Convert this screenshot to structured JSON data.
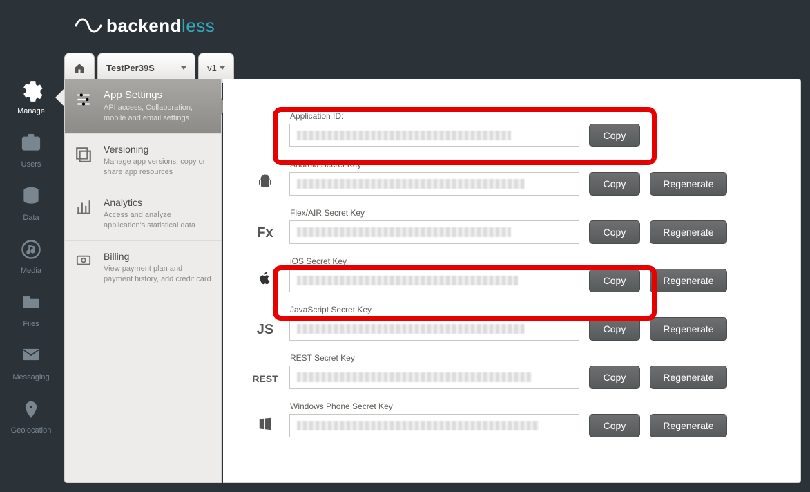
{
  "brand": {
    "name_a": "backend",
    "name_b": "less"
  },
  "app_selector": {
    "project": "TestPer39S",
    "version": "v1"
  },
  "left_rail": [
    {
      "id": "manage",
      "label": "Manage",
      "glyph": "gear",
      "active": true
    },
    {
      "id": "users",
      "label": "Users",
      "glyph": "idcard",
      "active": false
    },
    {
      "id": "data",
      "label": "Data",
      "glyph": "db",
      "active": false
    },
    {
      "id": "media",
      "label": "Media",
      "glyph": "music",
      "active": false
    },
    {
      "id": "files",
      "label": "Files",
      "glyph": "folder",
      "active": false
    },
    {
      "id": "messaging",
      "label": "Messaging",
      "glyph": "envelope",
      "active": false
    },
    {
      "id": "geolocation",
      "label": "Geolocation",
      "glyph": "pin",
      "active": false
    }
  ],
  "side_nav": [
    {
      "id": "appsettings",
      "title": "App Settings",
      "subtitle": "API access, Collaboration, mobile and email settings",
      "glyph": "sliders",
      "active": true
    },
    {
      "id": "versioning",
      "title": "Versioning",
      "subtitle": "Manage app versions, copy or share app resources",
      "glyph": "stack",
      "active": false
    },
    {
      "id": "analytics",
      "title": "Analytics",
      "subtitle": "Access and analyze application's statistical data",
      "glyph": "chart",
      "active": false
    },
    {
      "id": "billing",
      "title": "Billing",
      "subtitle": "View payment plan and payment history, add credit card",
      "glyph": "money",
      "active": false
    }
  ],
  "buttons": {
    "copy": "Copy",
    "regenerate": "Regenerate"
  },
  "credentials": [
    {
      "id": "appid",
      "label": "Application ID:",
      "icon": "",
      "has_regen": false,
      "strip_w": 310
    },
    {
      "id": "android",
      "label": "Android Secret Key",
      "icon": "android",
      "has_regen": true,
      "strip_w": 330
    },
    {
      "id": "flex",
      "label": "Flex/AIR Secret Key",
      "icon": "Fx",
      "has_regen": true,
      "strip_w": 310
    },
    {
      "id": "ios",
      "label": "iOS Secret Key",
      "icon": "apple",
      "has_regen": true,
      "strip_w": 320
    },
    {
      "id": "js",
      "label": "JavaScript Secret Key",
      "icon": "JS",
      "has_regen": true,
      "strip_w": 330
    },
    {
      "id": "rest",
      "label": "REST Secret Key",
      "icon": "REST",
      "has_regen": true,
      "strip_w": 340
    },
    {
      "id": "wp",
      "label": "Windows Phone Secret Key",
      "icon": "windows",
      "has_regen": true,
      "strip_w": 350
    }
  ]
}
